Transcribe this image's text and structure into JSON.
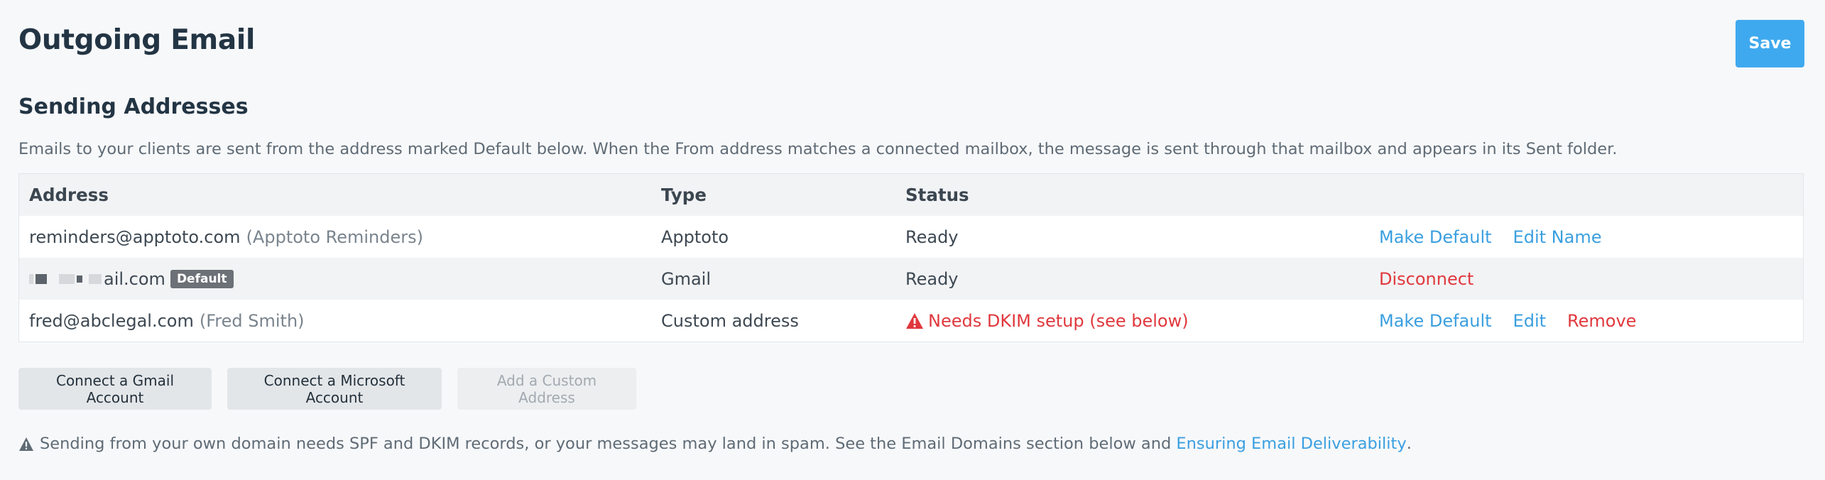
{
  "header": {
    "title": "Outgoing Email",
    "save_label": "Save"
  },
  "section": {
    "title": "Sending Addresses",
    "description": "Emails to your clients are sent from the address marked Default below. When the From address matches a connected mailbox, the message is sent through that mailbox and appears in its Sent folder."
  },
  "table": {
    "columns": [
      "Address",
      "Type",
      "Status"
    ],
    "rows": [
      {
        "address": "reminders@apptoto.com",
        "display_name": "(Apptoto Reminders)",
        "type": "Apptoto",
        "status": "Ready",
        "actions": [
          "Make Default",
          "Edit Name"
        ]
      },
      {
        "address_visible_part": "ail.com",
        "badge": "Default",
        "type": "Gmail",
        "status": "Ready",
        "actions": [
          "Disconnect"
        ]
      },
      {
        "address": "fred@abclegal.com",
        "display_name": "(Fred Smith)",
        "type": "Custom address",
        "status": "Needs DKIM setup (see below)",
        "actions": [
          "Make Default",
          "Edit",
          "Remove"
        ]
      }
    ]
  },
  "buttons": {
    "connect_gmail": "Connect a Gmail Account",
    "connect_microsoft": "Connect a Microsoft Account",
    "add_custom": "Add a Custom Address"
  },
  "note": {
    "text": "Sending from your own domain needs SPF and DKIM records, or your messages may land in spam. See the Email Domains section below and",
    "link": "Ensuring Email Deliverability",
    "suffix": "."
  },
  "colors": {
    "primary": "#3fa9ef",
    "link": "#3a9fe0",
    "danger": "#e0383d",
    "heading": "#233544"
  },
  "icons": [
    "warning-icon"
  ]
}
